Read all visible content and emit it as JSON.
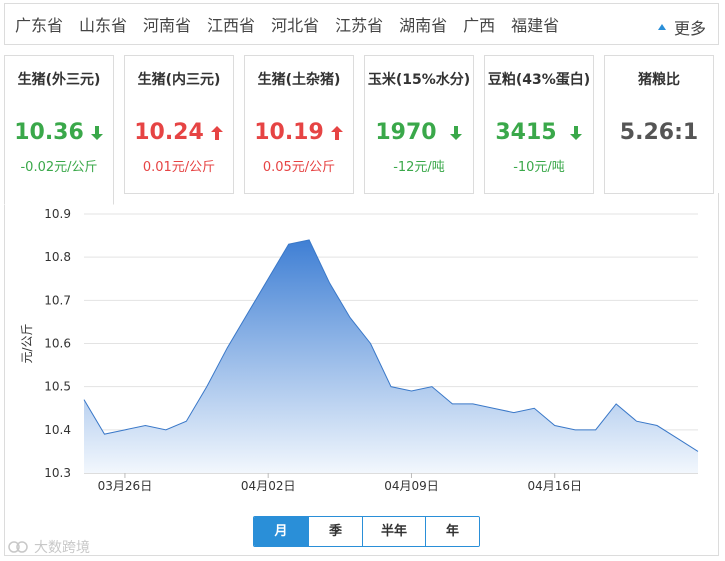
{
  "regions": [
    "广东省",
    "山东省",
    "河南省",
    "江西省",
    "河北省",
    "江苏省",
    "湖南省",
    "广西",
    "福建省"
  ],
  "more_label": "更多",
  "cards": [
    {
      "label": "生猪(外三元)",
      "value": "10.36",
      "trend": "down",
      "change": "-0.02元/公斤",
      "active": true
    },
    {
      "label": "生猪(内三元)",
      "value": "10.24",
      "trend": "up",
      "change": "0.01元/公斤"
    },
    {
      "label": "生猪(土杂猪)",
      "value": "10.19",
      "trend": "up",
      "change": "0.05元/公斤"
    },
    {
      "label": "玉米(15%水分)",
      "value": "1970",
      "trend": "down",
      "change": "-12元/吨"
    },
    {
      "label": "豆粕(43%蛋白)",
      "value": "3415",
      "trend": "down",
      "change": "-10元/吨"
    },
    {
      "label": "猪粮比",
      "value": "5.26:1",
      "trend": "none",
      "change": ""
    }
  ],
  "colors": {
    "down": "#3aa84a",
    "up": "#e64444",
    "accent": "#2a8fd8",
    "area_top": "#3f7fd4",
    "area_bottom": "#f2f7fd"
  },
  "chart_data": {
    "type": "area",
    "ylabel": "元/公斤",
    "ylim": [
      10.3,
      10.9
    ],
    "yticks": [
      "10.3",
      "10.4",
      "10.5",
      "10.6",
      "10.7",
      "10.8",
      "10.9"
    ],
    "xticks": [
      "03月26日",
      "04月02日",
      "04月09日",
      "04月16日"
    ],
    "grid": true,
    "series": [
      {
        "values": [
          10.47,
          10.39,
          10.4,
          10.41,
          10.4,
          10.42,
          10.5,
          10.59,
          10.67,
          10.75,
          10.83,
          10.84,
          10.74,
          10.66,
          10.6,
          10.5,
          10.49,
          10.5,
          10.46,
          10.46,
          10.45,
          10.44,
          10.45,
          10.41,
          10.4,
          10.4,
          10.46,
          10.42,
          10.41,
          10.38,
          10.35
        ]
      }
    ]
  },
  "period": {
    "options": [
      "月",
      "季",
      "半年",
      "年"
    ],
    "selected": 0
  },
  "watermark": "大数跨境"
}
